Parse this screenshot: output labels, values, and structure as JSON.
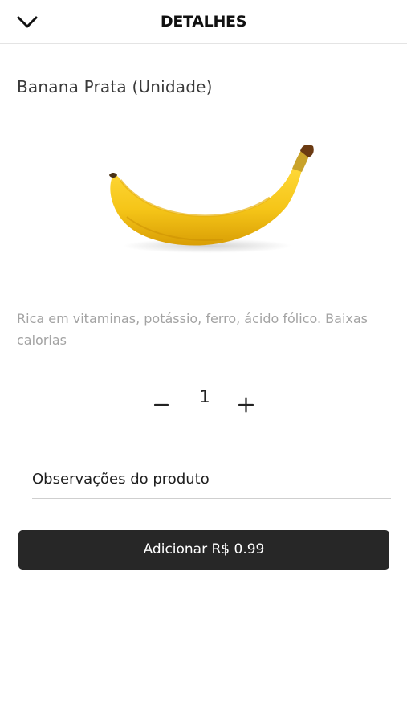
{
  "header": {
    "title": "DETALHES",
    "back_icon": "chevron-down-icon"
  },
  "product": {
    "name": "Banana Prata (Unidade)",
    "image_icon": "banana-image",
    "description": "Rica em vitaminas, potássio, ferro, ácido fólico. Baixas calorias"
  },
  "quantity": {
    "value": "1",
    "minus_icon": "minus-icon",
    "plus_icon": "plus-icon"
  },
  "notes": {
    "placeholder": "Observações do produto",
    "value": ""
  },
  "add_button": {
    "label": "Adicionar R$ 0.99"
  },
  "colors": {
    "button_bg": "#272727",
    "description_text": "#a3a3a3",
    "banana_yellow": "#f5c518"
  }
}
